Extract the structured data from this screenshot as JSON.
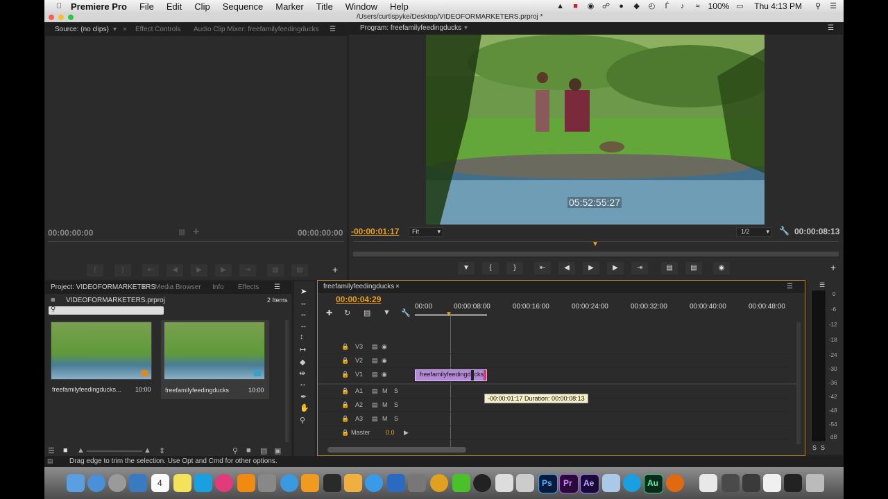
{
  "menubar": {
    "app_name": "Premiere Pro",
    "items": [
      "File",
      "Edit",
      "Clip",
      "Sequence",
      "Marker",
      "Title",
      "Window",
      "Help"
    ],
    "battery": "100%",
    "clock": "Thu 4:13 PM"
  },
  "window": {
    "title": "/Users/curtispyke/Desktop/VIDEOFORMARKETERS.prproj *"
  },
  "source_panel": {
    "tabs": [
      "Source: (no clips)",
      "Effect Controls",
      "Audio Clip Mixer: freefamilyfeedingducks"
    ],
    "timecode_left": "00:00:00:00",
    "timecode_right": "00:00:00:00"
  },
  "program_panel": {
    "tab": "Program: freefamilyfeedingducks",
    "overlay_timecode": "05:52:55:27",
    "timecode_left": "-00:00:01:17",
    "fit": "Fit",
    "resolution": "1/2",
    "timecode_right": "00:00:08:13"
  },
  "project_panel": {
    "tabs": [
      "Project: VIDEOFORMARKETERS",
      "Media Browser",
      "Info",
      "Effects"
    ],
    "project_file": "VIDEOFORMARKETERS.prproj",
    "item_count": "2 Items",
    "items": [
      {
        "name": "freefamilyfeedingducks...",
        "duration": "10:00"
      },
      {
        "name": "freefamilyfeedingducks",
        "duration": "10:00"
      }
    ]
  },
  "timeline": {
    "tab": "freefamilyfeedingducks",
    "playhead_timecode": "00:00:04:29",
    "ruler": [
      "00:00",
      "00:00:08:00",
      "00:00:16:00",
      "00:00:24:00",
      "00:00:32:00",
      "00:00:40:00",
      "00:00:48:00"
    ],
    "video_tracks": [
      "V3",
      "V2",
      "V1"
    ],
    "audio_tracks": [
      "A1",
      "A2",
      "A3"
    ],
    "mute_label": "M",
    "solo_label": "S",
    "master_label": "Master",
    "master_value": "0.0",
    "clip_label": "freefamilyfeedingducks",
    "tooltip": "-00:00:01:17 Duration: 00:00:08:13"
  },
  "audio_meter": {
    "scale": [
      "0",
      "-6",
      "-12",
      "-18",
      "-24",
      "-30",
      "-36",
      "-42",
      "-48",
      "-54",
      "dB"
    ],
    "solo_labels": [
      "S",
      "S"
    ]
  },
  "status_bar": {
    "text": "Drag edge to trim the selection. Use Opt and Cmd for other options."
  },
  "dock": {
    "apps": [
      "Ps",
      "Pr",
      "Ae",
      "Au"
    ],
    "calendar_day": "4"
  },
  "colors": {
    "accent_timecode": "#e8a21a",
    "clip": "#b48ad8",
    "playhead": "#d23a3a",
    "tooltip_bg": "#f5f0c8"
  }
}
